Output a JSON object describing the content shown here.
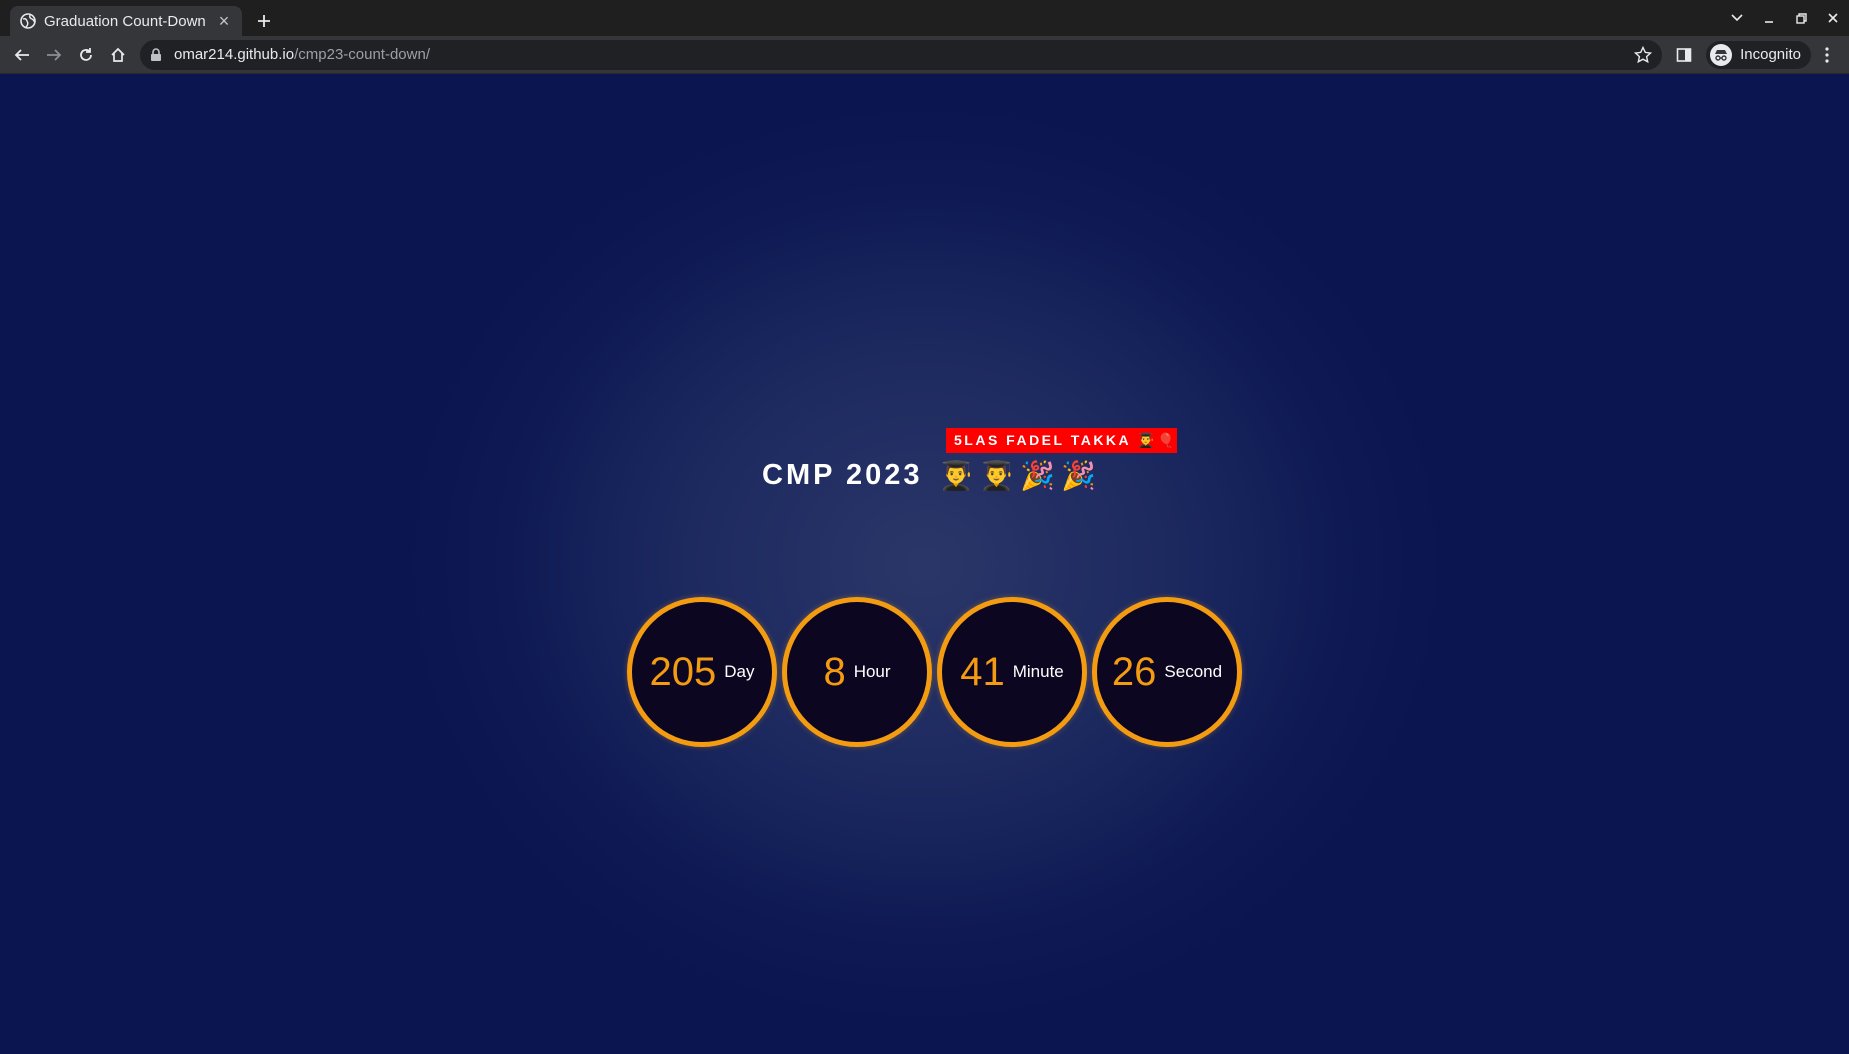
{
  "browser": {
    "tab": {
      "title": "Graduation Count-Down",
      "favicon": "globe-icon"
    },
    "address": {
      "host": "omar214.github.io",
      "path": "/cmp23-count-down/"
    },
    "profile": {
      "label": "Incognito",
      "icon": "incognito-icon"
    }
  },
  "page": {
    "banner": "5LAS FADEL TAKKA 👨‍🎓🎈",
    "title": "CMP 2023",
    "title_emojis": "👨‍🎓👨‍🎓🎉🎉",
    "countdown": [
      {
        "value": "205",
        "unit": "Day"
      },
      {
        "value": "8",
        "unit": "Hour"
      },
      {
        "value": "41",
        "unit": "Minute"
      },
      {
        "value": "26",
        "unit": "Second"
      }
    ],
    "colors": {
      "accent": "#f39c12",
      "banner": "#ff0000",
      "background": "#0b1550"
    }
  }
}
